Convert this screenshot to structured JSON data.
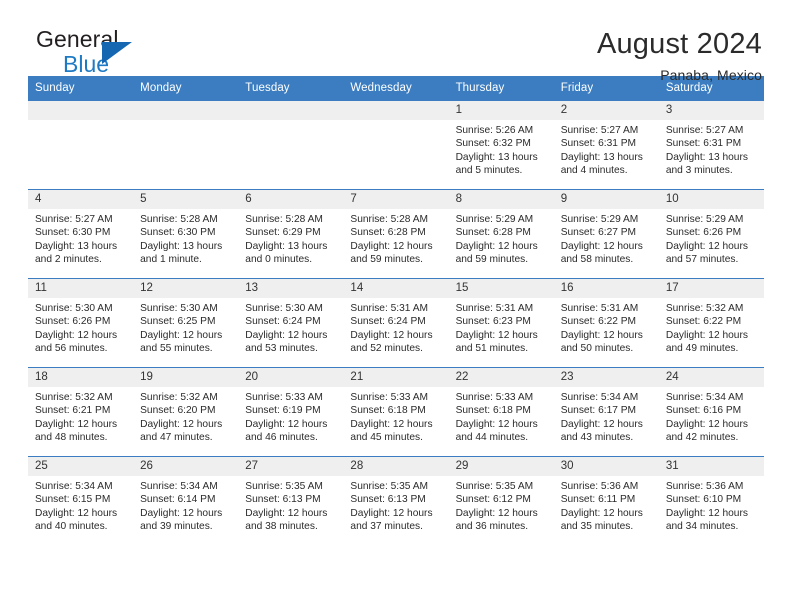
{
  "brand": {
    "name_top": "General",
    "name_bottom": "Blue",
    "accent_color": "#1567b2"
  },
  "header": {
    "title": "August 2024",
    "subtitle": "Panaba, Mexico"
  },
  "theme": {
    "header_row_bg": "#3b7dc0",
    "daynum_bg": "#efefef",
    "grid_line": "#3b7dc0"
  },
  "weekday_headers": [
    "Sunday",
    "Monday",
    "Tuesday",
    "Wednesday",
    "Thursday",
    "Friday",
    "Saturday"
  ],
  "weeks": [
    [
      {
        "day": "",
        "empty": true,
        "sunrise": "",
        "sunset": "",
        "daylight1": "",
        "daylight2": ""
      },
      {
        "day": "",
        "empty": true,
        "sunrise": "",
        "sunset": "",
        "daylight1": "",
        "daylight2": ""
      },
      {
        "day": "",
        "empty": true,
        "sunrise": "",
        "sunset": "",
        "daylight1": "",
        "daylight2": ""
      },
      {
        "day": "",
        "empty": true,
        "sunrise": "",
        "sunset": "",
        "daylight1": "",
        "daylight2": ""
      },
      {
        "day": "1",
        "empty": false,
        "sunrise": "Sunrise: 5:26 AM",
        "sunset": "Sunset: 6:32 PM",
        "daylight1": "Daylight: 13 hours",
        "daylight2": "and 5 minutes."
      },
      {
        "day": "2",
        "empty": false,
        "sunrise": "Sunrise: 5:27 AM",
        "sunset": "Sunset: 6:31 PM",
        "daylight1": "Daylight: 13 hours",
        "daylight2": "and 4 minutes."
      },
      {
        "day": "3",
        "empty": false,
        "sunrise": "Sunrise: 5:27 AM",
        "sunset": "Sunset: 6:31 PM",
        "daylight1": "Daylight: 13 hours",
        "daylight2": "and 3 minutes."
      }
    ],
    [
      {
        "day": "4",
        "empty": false,
        "sunrise": "Sunrise: 5:27 AM",
        "sunset": "Sunset: 6:30 PM",
        "daylight1": "Daylight: 13 hours",
        "daylight2": "and 2 minutes."
      },
      {
        "day": "5",
        "empty": false,
        "sunrise": "Sunrise: 5:28 AM",
        "sunset": "Sunset: 6:30 PM",
        "daylight1": "Daylight: 13 hours",
        "daylight2": "and 1 minute."
      },
      {
        "day": "6",
        "empty": false,
        "sunrise": "Sunrise: 5:28 AM",
        "sunset": "Sunset: 6:29 PM",
        "daylight1": "Daylight: 13 hours",
        "daylight2": "and 0 minutes."
      },
      {
        "day": "7",
        "empty": false,
        "sunrise": "Sunrise: 5:28 AM",
        "sunset": "Sunset: 6:28 PM",
        "daylight1": "Daylight: 12 hours",
        "daylight2": "and 59 minutes."
      },
      {
        "day": "8",
        "empty": false,
        "sunrise": "Sunrise: 5:29 AM",
        "sunset": "Sunset: 6:28 PM",
        "daylight1": "Daylight: 12 hours",
        "daylight2": "and 59 minutes."
      },
      {
        "day": "9",
        "empty": false,
        "sunrise": "Sunrise: 5:29 AM",
        "sunset": "Sunset: 6:27 PM",
        "daylight1": "Daylight: 12 hours",
        "daylight2": "and 58 minutes."
      },
      {
        "day": "10",
        "empty": false,
        "sunrise": "Sunrise: 5:29 AM",
        "sunset": "Sunset: 6:26 PM",
        "daylight1": "Daylight: 12 hours",
        "daylight2": "and 57 minutes."
      }
    ],
    [
      {
        "day": "11",
        "empty": false,
        "sunrise": "Sunrise: 5:30 AM",
        "sunset": "Sunset: 6:26 PM",
        "daylight1": "Daylight: 12 hours",
        "daylight2": "and 56 minutes."
      },
      {
        "day": "12",
        "empty": false,
        "sunrise": "Sunrise: 5:30 AM",
        "sunset": "Sunset: 6:25 PM",
        "daylight1": "Daylight: 12 hours",
        "daylight2": "and 55 minutes."
      },
      {
        "day": "13",
        "empty": false,
        "sunrise": "Sunrise: 5:30 AM",
        "sunset": "Sunset: 6:24 PM",
        "daylight1": "Daylight: 12 hours",
        "daylight2": "and 53 minutes."
      },
      {
        "day": "14",
        "empty": false,
        "sunrise": "Sunrise: 5:31 AM",
        "sunset": "Sunset: 6:24 PM",
        "daylight1": "Daylight: 12 hours",
        "daylight2": "and 52 minutes."
      },
      {
        "day": "15",
        "empty": false,
        "sunrise": "Sunrise: 5:31 AM",
        "sunset": "Sunset: 6:23 PM",
        "daylight1": "Daylight: 12 hours",
        "daylight2": "and 51 minutes."
      },
      {
        "day": "16",
        "empty": false,
        "sunrise": "Sunrise: 5:31 AM",
        "sunset": "Sunset: 6:22 PM",
        "daylight1": "Daylight: 12 hours",
        "daylight2": "and 50 minutes."
      },
      {
        "day": "17",
        "empty": false,
        "sunrise": "Sunrise: 5:32 AM",
        "sunset": "Sunset: 6:22 PM",
        "daylight1": "Daylight: 12 hours",
        "daylight2": "and 49 minutes."
      }
    ],
    [
      {
        "day": "18",
        "empty": false,
        "sunrise": "Sunrise: 5:32 AM",
        "sunset": "Sunset: 6:21 PM",
        "daylight1": "Daylight: 12 hours",
        "daylight2": "and 48 minutes."
      },
      {
        "day": "19",
        "empty": false,
        "sunrise": "Sunrise: 5:32 AM",
        "sunset": "Sunset: 6:20 PM",
        "daylight1": "Daylight: 12 hours",
        "daylight2": "and 47 minutes."
      },
      {
        "day": "20",
        "empty": false,
        "sunrise": "Sunrise: 5:33 AM",
        "sunset": "Sunset: 6:19 PM",
        "daylight1": "Daylight: 12 hours",
        "daylight2": "and 46 minutes."
      },
      {
        "day": "21",
        "empty": false,
        "sunrise": "Sunrise: 5:33 AM",
        "sunset": "Sunset: 6:18 PM",
        "daylight1": "Daylight: 12 hours",
        "daylight2": "and 45 minutes."
      },
      {
        "day": "22",
        "empty": false,
        "sunrise": "Sunrise: 5:33 AM",
        "sunset": "Sunset: 6:18 PM",
        "daylight1": "Daylight: 12 hours",
        "daylight2": "and 44 minutes."
      },
      {
        "day": "23",
        "empty": false,
        "sunrise": "Sunrise: 5:34 AM",
        "sunset": "Sunset: 6:17 PM",
        "daylight1": "Daylight: 12 hours",
        "daylight2": "and 43 minutes."
      },
      {
        "day": "24",
        "empty": false,
        "sunrise": "Sunrise: 5:34 AM",
        "sunset": "Sunset: 6:16 PM",
        "daylight1": "Daylight: 12 hours",
        "daylight2": "and 42 minutes."
      }
    ],
    [
      {
        "day": "25",
        "empty": false,
        "sunrise": "Sunrise: 5:34 AM",
        "sunset": "Sunset: 6:15 PM",
        "daylight1": "Daylight: 12 hours",
        "daylight2": "and 40 minutes."
      },
      {
        "day": "26",
        "empty": false,
        "sunrise": "Sunrise: 5:34 AM",
        "sunset": "Sunset: 6:14 PM",
        "daylight1": "Daylight: 12 hours",
        "daylight2": "and 39 minutes."
      },
      {
        "day": "27",
        "empty": false,
        "sunrise": "Sunrise: 5:35 AM",
        "sunset": "Sunset: 6:13 PM",
        "daylight1": "Daylight: 12 hours",
        "daylight2": "and 38 minutes."
      },
      {
        "day": "28",
        "empty": false,
        "sunrise": "Sunrise: 5:35 AM",
        "sunset": "Sunset: 6:13 PM",
        "daylight1": "Daylight: 12 hours",
        "daylight2": "and 37 minutes."
      },
      {
        "day": "29",
        "empty": false,
        "sunrise": "Sunrise: 5:35 AM",
        "sunset": "Sunset: 6:12 PM",
        "daylight1": "Daylight: 12 hours",
        "daylight2": "and 36 minutes."
      },
      {
        "day": "30",
        "empty": false,
        "sunrise": "Sunrise: 5:36 AM",
        "sunset": "Sunset: 6:11 PM",
        "daylight1": "Daylight: 12 hours",
        "daylight2": "and 35 minutes."
      },
      {
        "day": "31",
        "empty": false,
        "sunrise": "Sunrise: 5:36 AM",
        "sunset": "Sunset: 6:10 PM",
        "daylight1": "Daylight: 12 hours",
        "daylight2": "and 34 minutes."
      }
    ]
  ]
}
